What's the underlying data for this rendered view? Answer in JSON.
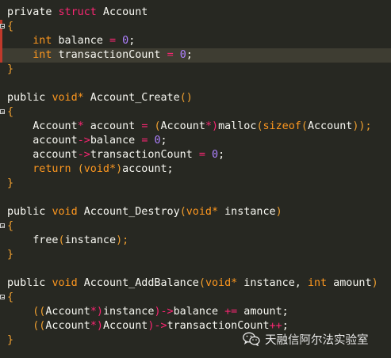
{
  "editor": {
    "lines": [
      {
        "highlight": false,
        "fold": false,
        "marker": "",
        "tokens": [
          {
            "t": "private ",
            "c": "plain"
          },
          {
            "t": "struct",
            "c": "kw"
          },
          {
            "t": " Account",
            "c": "plain"
          }
        ]
      },
      {
        "highlight": false,
        "fold": true,
        "marker": "#c0392b",
        "tokens": [
          {
            "t": "{",
            "c": "brace"
          }
        ]
      },
      {
        "highlight": false,
        "fold": false,
        "marker": "#c0392b",
        "tokens": [
          {
            "t": "    ",
            "c": "plain"
          },
          {
            "t": "int",
            "c": "orange"
          },
          {
            "t": " balance ",
            "c": "plain"
          },
          {
            "t": "=",
            "c": "op"
          },
          {
            "t": " ",
            "c": "plain"
          },
          {
            "t": "0",
            "c": "num"
          },
          {
            "t": ";",
            "c": "plain"
          }
        ]
      },
      {
        "highlight": true,
        "fold": false,
        "marker": "#c0392b",
        "tokens": [
          {
            "t": "    ",
            "c": "plain"
          },
          {
            "t": "int",
            "c": "orange"
          },
          {
            "t": " transactionCount ",
            "c": "plain"
          },
          {
            "t": "=",
            "c": "op"
          },
          {
            "t": " ",
            "c": "plain"
          },
          {
            "t": "0",
            "c": "num"
          },
          {
            "t": ";",
            "c": "plain"
          }
        ]
      },
      {
        "highlight": false,
        "fold": false,
        "marker": "",
        "tokens": [
          {
            "t": "}",
            "c": "brace"
          }
        ]
      },
      {
        "highlight": false,
        "fold": false,
        "marker": "",
        "tokens": []
      },
      {
        "highlight": false,
        "fold": false,
        "marker": "",
        "tokens": [
          {
            "t": "public ",
            "c": "plain"
          },
          {
            "t": "void*",
            "c": "orange"
          },
          {
            "t": " Account_Create",
            "c": "plain"
          },
          {
            "t": "()",
            "c": "brace"
          }
        ]
      },
      {
        "highlight": false,
        "fold": true,
        "marker": "",
        "tokens": [
          {
            "t": "{",
            "c": "brace"
          }
        ]
      },
      {
        "highlight": false,
        "fold": false,
        "marker": "",
        "tokens": [
          {
            "t": "    Account",
            "c": "plain"
          },
          {
            "t": "*",
            "c": "op"
          },
          {
            "t": " account ",
            "c": "plain"
          },
          {
            "t": "=",
            "c": "op"
          },
          {
            "t": " ",
            "c": "plain"
          },
          {
            "t": "(",
            "c": "brace"
          },
          {
            "t": "Account",
            "c": "plain"
          },
          {
            "t": "*)",
            "c": "op"
          },
          {
            "t": "malloc",
            "c": "plain"
          },
          {
            "t": "(",
            "c": "brace"
          },
          {
            "t": "sizeof",
            "c": "orange"
          },
          {
            "t": "(",
            "c": "brace"
          },
          {
            "t": "Account",
            "c": "plain"
          },
          {
            "t": "));",
            "c": "brace"
          }
        ]
      },
      {
        "highlight": false,
        "fold": false,
        "marker": "",
        "tokens": [
          {
            "t": "    account",
            "c": "plain"
          },
          {
            "t": "->",
            "c": "op"
          },
          {
            "t": "balance ",
            "c": "plain"
          },
          {
            "t": "=",
            "c": "op"
          },
          {
            "t": " ",
            "c": "plain"
          },
          {
            "t": "0",
            "c": "num"
          },
          {
            "t": ";",
            "c": "plain"
          }
        ]
      },
      {
        "highlight": false,
        "fold": false,
        "marker": "",
        "tokens": [
          {
            "t": "    account",
            "c": "plain"
          },
          {
            "t": "->",
            "c": "op"
          },
          {
            "t": "transactionCount ",
            "c": "plain"
          },
          {
            "t": "=",
            "c": "op"
          },
          {
            "t": " ",
            "c": "plain"
          },
          {
            "t": "0",
            "c": "num"
          },
          {
            "t": ";",
            "c": "plain"
          }
        ]
      },
      {
        "highlight": false,
        "fold": false,
        "marker": "",
        "tokens": [
          {
            "t": "    ",
            "c": "plain"
          },
          {
            "t": "return",
            "c": "orange"
          },
          {
            "t": " ",
            "c": "plain"
          },
          {
            "t": "(",
            "c": "brace"
          },
          {
            "t": "void*",
            "c": "orange"
          },
          {
            "t": ")",
            "c": "brace"
          },
          {
            "t": "account;",
            "c": "plain"
          }
        ]
      },
      {
        "highlight": false,
        "fold": false,
        "marker": "",
        "tokens": [
          {
            "t": "}",
            "c": "brace"
          }
        ]
      },
      {
        "highlight": false,
        "fold": false,
        "marker": "",
        "tokens": []
      },
      {
        "highlight": false,
        "fold": false,
        "marker": "",
        "tokens": [
          {
            "t": "public ",
            "c": "plain"
          },
          {
            "t": "void",
            "c": "orange"
          },
          {
            "t": " Account_Destroy",
            "c": "plain"
          },
          {
            "t": "(",
            "c": "brace"
          },
          {
            "t": "void*",
            "c": "orange"
          },
          {
            "t": " instance",
            "c": "plain"
          },
          {
            "t": ")",
            "c": "brace"
          }
        ]
      },
      {
        "highlight": false,
        "fold": true,
        "marker": "",
        "tokens": [
          {
            "t": "{",
            "c": "brace"
          }
        ]
      },
      {
        "highlight": false,
        "fold": false,
        "marker": "",
        "tokens": [
          {
            "t": "    free",
            "c": "plain"
          },
          {
            "t": "(",
            "c": "brace"
          },
          {
            "t": "instance",
            "c": "plain"
          },
          {
            "t": ");",
            "c": "brace"
          }
        ]
      },
      {
        "highlight": false,
        "fold": false,
        "marker": "",
        "tokens": [
          {
            "t": "}",
            "c": "brace"
          }
        ]
      },
      {
        "highlight": false,
        "fold": false,
        "marker": "",
        "tokens": []
      },
      {
        "highlight": false,
        "fold": false,
        "marker": "",
        "tokens": [
          {
            "t": "public ",
            "c": "plain"
          },
          {
            "t": "void",
            "c": "orange"
          },
          {
            "t": " Account_AddBalance",
            "c": "plain"
          },
          {
            "t": "(",
            "c": "brace"
          },
          {
            "t": "void*",
            "c": "orange"
          },
          {
            "t": " instance, ",
            "c": "plain"
          },
          {
            "t": "int",
            "c": "orange"
          },
          {
            "t": " amount",
            "c": "plain"
          },
          {
            "t": ")",
            "c": "brace"
          }
        ]
      },
      {
        "highlight": false,
        "fold": true,
        "marker": "",
        "tokens": [
          {
            "t": "{",
            "c": "brace"
          }
        ]
      },
      {
        "highlight": false,
        "fold": false,
        "marker": "",
        "tokens": [
          {
            "t": "    ((",
            "c": "brace"
          },
          {
            "t": "Account",
            "c": "plain"
          },
          {
            "t": "*)",
            "c": "op"
          },
          {
            "t": "instance",
            "c": "plain"
          },
          {
            "t": ")->",
            "c": "op"
          },
          {
            "t": "balance ",
            "c": "plain"
          },
          {
            "t": "+=",
            "c": "op"
          },
          {
            "t": " amount;",
            "c": "plain"
          }
        ]
      },
      {
        "highlight": false,
        "fold": false,
        "marker": "",
        "tokens": [
          {
            "t": "    ((",
            "c": "brace"
          },
          {
            "t": "Account",
            "c": "plain"
          },
          {
            "t": "*)",
            "c": "op"
          },
          {
            "t": "Account",
            "c": "plain"
          },
          {
            "t": ")->",
            "c": "op"
          },
          {
            "t": "transactionCount",
            "c": "plain"
          },
          {
            "t": "++",
            "c": "op"
          },
          {
            "t": ";",
            "c": "plain"
          }
        ]
      },
      {
        "highlight": false,
        "fold": false,
        "marker": "",
        "tokens": [
          {
            "t": "}",
            "c": "brace"
          }
        ]
      }
    ]
  },
  "watermark": {
    "icon": "wechat-icon",
    "text": "天融信阿尔法实验室"
  },
  "colors": {
    "background": "#272822",
    "highlight_line": "#3e3d32",
    "change_marker": "#c0392b"
  }
}
